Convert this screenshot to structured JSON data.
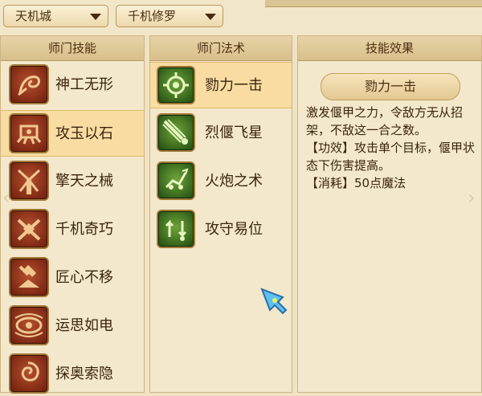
{
  "top": {
    "realm_dropdown": {
      "value": "天机城"
    },
    "sect_dropdown": {
      "value": "千机修罗"
    }
  },
  "panels": {
    "skills_title": "师门技能",
    "spells_title": "师门法术",
    "effect_title": "技能效果"
  },
  "skills": [
    {
      "label": "神工无形",
      "icon": "spiral-hand-icon"
    },
    {
      "label": "攻玉以石",
      "icon": "gear-crab-icon",
      "selected": true
    },
    {
      "label": "擎天之械",
      "icon": "windmill-icon"
    },
    {
      "label": "千机奇巧",
      "icon": "crossed-tools-icon"
    },
    {
      "label": "匠心不移",
      "icon": "hammer-anvil-icon"
    },
    {
      "label": "运思如电",
      "icon": "wave-eye-icon"
    },
    {
      "label": "探奥索隐",
      "icon": "swirl-icon"
    }
  ],
  "spells": [
    {
      "label": "勠力一击",
      "icon": "gear-fist-icon",
      "selected": true
    },
    {
      "label": "烈偃飞星",
      "icon": "shooting-star-icon"
    },
    {
      "label": "火炮之术",
      "icon": "dragon-cannon-icon"
    },
    {
      "label": "攻守易位",
      "icon": "swap-arrows-icon"
    }
  ],
  "effect": {
    "name": "勠力一击",
    "lines": [
      "激发偃甲之力，令敌方无从招架，不敌这一合之数。",
      "【功效】攻击单个目标，偃甲状态下伤害提高。",
      "【消耗】50点魔法"
    ]
  },
  "colors": {
    "selected_row": "#f8dca2",
    "panel_bg": "#f3e8cc",
    "skill_icon": "#8a2e16",
    "spell_icon": "#3f7a22"
  }
}
